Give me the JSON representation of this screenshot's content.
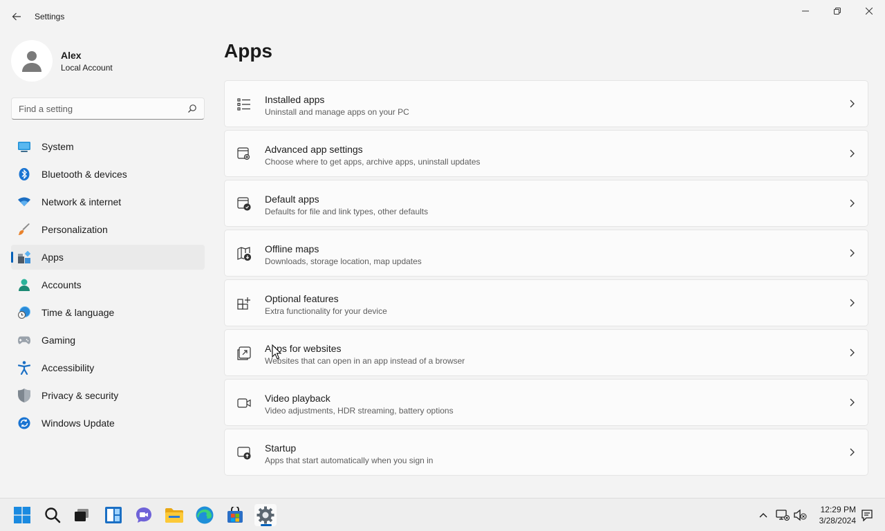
{
  "window": {
    "title": "Settings"
  },
  "profile": {
    "name": "Alex",
    "account_type": "Local Account"
  },
  "search": {
    "placeholder": "Find a setting"
  },
  "sidebar": {
    "items": [
      {
        "label": "System",
        "icon": "system-icon",
        "selected": false
      },
      {
        "label": "Bluetooth & devices",
        "icon": "bluetooth-icon",
        "selected": false
      },
      {
        "label": "Network & internet",
        "icon": "wifi-icon",
        "selected": false
      },
      {
        "label": "Personalization",
        "icon": "brush-icon",
        "selected": false
      },
      {
        "label": "Apps",
        "icon": "apps-icon",
        "selected": true
      },
      {
        "label": "Accounts",
        "icon": "accounts-icon",
        "selected": false
      },
      {
        "label": "Time & language",
        "icon": "globe-clock-icon",
        "selected": false
      },
      {
        "label": "Gaming",
        "icon": "gamepad-icon",
        "selected": false
      },
      {
        "label": "Accessibility",
        "icon": "accessibility-icon",
        "selected": false
      },
      {
        "label": "Privacy & security",
        "icon": "shield-icon",
        "selected": false
      },
      {
        "label": "Windows Update",
        "icon": "update-icon",
        "selected": false
      }
    ]
  },
  "main": {
    "title": "Apps",
    "cards": [
      {
        "title": "Installed apps",
        "description": "Uninstall and manage apps on your PC",
        "icon": "list-icon"
      },
      {
        "title": "Advanced app settings",
        "description": "Choose where to get apps, archive apps, uninstall updates",
        "icon": "app-settings-icon"
      },
      {
        "title": "Default apps",
        "description": "Defaults for file and link types, other defaults",
        "icon": "default-apps-icon"
      },
      {
        "title": "Offline maps",
        "description": "Downloads, storage location, map updates",
        "icon": "map-download-icon"
      },
      {
        "title": "Optional features",
        "description": "Extra functionality for your device",
        "icon": "grid-plus-icon"
      },
      {
        "title": "Apps for websites",
        "description": "Websites that can open in an app instead of a browser",
        "icon": "open-external-icon"
      },
      {
        "title": "Video playback",
        "description": "Video adjustments, HDR streaming, battery options",
        "icon": "video-icon"
      },
      {
        "title": "Startup",
        "description": "Apps that start automatically when you sign in",
        "icon": "startup-icon"
      }
    ]
  },
  "taskbar": {
    "apps": [
      "start-icon",
      "search-icon",
      "task-view-icon",
      "widgets-icon",
      "chat-icon",
      "file-explorer-icon",
      "edge-icon",
      "store-icon",
      "settings-icon"
    ],
    "active_app": "settings-icon",
    "time": "12:29 PM",
    "date": "3/28/2024"
  },
  "colors": {
    "accent": "#005fb8",
    "background": "#f3f3f3",
    "card": "#fbfbfb"
  }
}
